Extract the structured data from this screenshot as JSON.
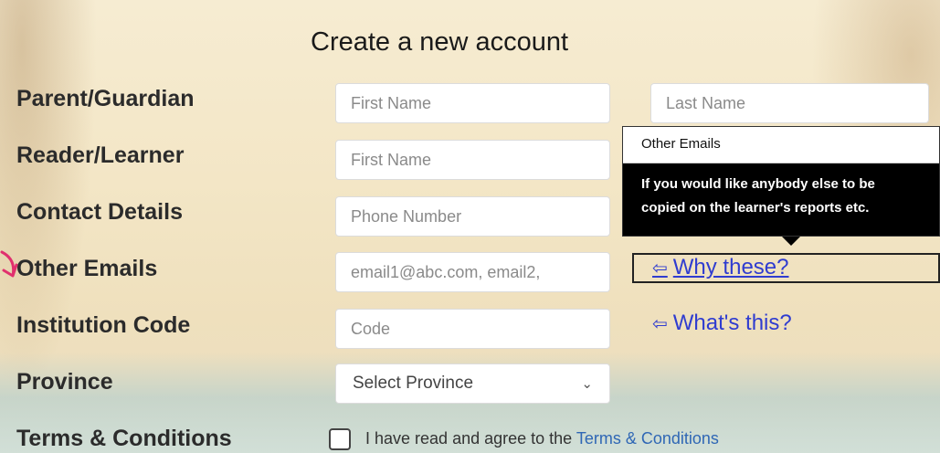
{
  "title": "Create a new account",
  "labels": {
    "parent": "Parent/Guardian",
    "reader": "Reader/Learner",
    "contact": "Contact Details",
    "emails": "Other Emails",
    "institution": "Institution Code",
    "province": "Province",
    "terms": "Terms & Conditions"
  },
  "fields": {
    "parent_first": "First Name",
    "parent_last": "Last Name",
    "reader_first": "First Name",
    "phone": "Phone Number",
    "emails": "email1@abc.com, email2,",
    "code": "Code"
  },
  "province": {
    "selected": "Select Province"
  },
  "tooltip": {
    "title": "Other Emails",
    "line1": "If you would like anybody else to be",
    "line2": "copied on the learner's reports etc."
  },
  "links": {
    "why": "Why these?",
    "what": "What's this?",
    "arrow": "⇦"
  },
  "agree": {
    "prefix": "I have read and agree to the",
    "link": "Terms & Conditions"
  },
  "colors": {
    "link": "#2f3cd0",
    "accent_arrow": "#e0306e"
  }
}
